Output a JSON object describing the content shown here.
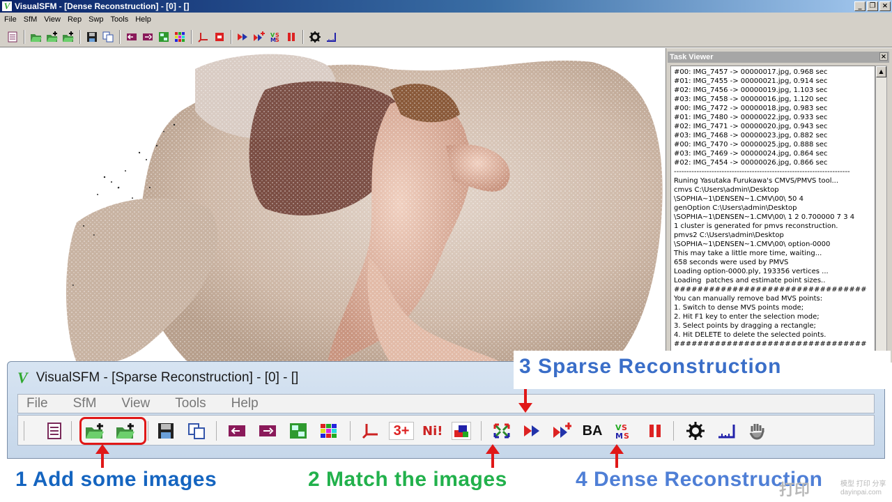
{
  "window": {
    "title": "VisualSFM - [Dense Reconstruction] - [0] - []",
    "logo": "V",
    "controls": {
      "minimize": "_",
      "restore": "❐",
      "close": "×"
    }
  },
  "menu": [
    "File",
    "SfM",
    "View",
    "Rep",
    "Swp",
    "Tools",
    "Help"
  ],
  "toolbar_icons": [
    "log-icon",
    "open-icon",
    "add-images-icon",
    "add-more-icon",
    "save-icon",
    "copy-icon",
    "prev-icon",
    "next-icon",
    "2d3d-icon",
    "grid-icon",
    "axis-icon",
    "stop-icon",
    "run-icon",
    "run-plus-icon",
    "cmvs-icon",
    "pause-icon",
    "gear-icon",
    "ruler-icon"
  ],
  "task_viewer": {
    "title": "Task Viewer",
    "close": "×",
    "lines": [
      "#00: IMG_7457 -> 00000017.jpg, 0.968 sec",
      "#01: IMG_7455 -> 00000021.jpg, 0.914 sec",
      "#02: IMG_7456 -> 00000019.jpg, 1.103 sec",
      "#03: IMG_7458 -> 00000016.jpg, 1.120 sec",
      "#00: IMG_7472 -> 00000018.jpg, 0.983 sec",
      "#01: IMG_7480 -> 00000022.jpg, 0.933 sec",
      "#02: IMG_7471 -> 00000020.jpg, 0.943 sec",
      "#03: IMG_7468 -> 00000023.jpg, 0.882 sec",
      "#00: IMG_7470 -> 00000025.jpg, 0.888 sec",
      "#03: IMG_7469 -> 00000024.jpg, 0.864 sec",
      "#02: IMG_7454 -> 00000026.jpg, 0.866 sec",
      "----------------------------------------------------------------------",
      "Runing Yasutaka Furukawa's CMVS/PMVS tool...",
      "cmvs C:\\Users\\admin\\Desktop",
      "\\SOPHIA~1\\DENSEN~1.CMV\\00\\ 50 4",
      "genOption C:\\Users\\admin\\Desktop",
      "\\SOPHIA~1\\DENSEN~1.CMV\\00\\ 1 2 0.700000 7 3 4",
      "1 cluster is generated for pmvs reconstruction.",
      "pmvs2 C:\\Users\\admin\\Desktop",
      "\\SOPHIA~1\\DENSEN~1.CMV\\00\\ option-0000",
      "This may take a little more time, waiting...",
      "658 seconds were used by PMVS",
      "Loading option-0000.ply, 193356 vertices ...",
      "Loading  patches and estimate point sizes..",
      "#################################",
      "You can manually remove bad MVS points:",
      "1. Switch to dense MVS points mode;",
      "2. Hit F1 key to enter the selection mode;",
      "3. Select points by dragging a rectangle;",
      "4. Hit DELETE to delete the selected points.",
      "#################################"
    ],
    "scroll_up": "▲"
  },
  "inset": {
    "logo": "V",
    "title": "VisualSFM - [Sparse Reconstruction] - [0] - []",
    "menu": [
      "File",
      "SfM",
      "View",
      "Tools",
      "Help"
    ],
    "icons": {
      "three_plus": "3+",
      "ba": "BA"
    }
  },
  "annotations": {
    "step1": "1 Add some images",
    "step2": "2 Match the images",
    "step3": "3 Sparse Reconstruction",
    "step4": "4 Dense Reconstruction"
  },
  "colors": {
    "step1": "#1565c0",
    "step2": "#22b14c",
    "step3": "#3a6ec8",
    "step4": "#4f7fd6",
    "arrow": "#e01818"
  },
  "watermark": {
    "mark": "打印",
    "line1": "模型 打印 分享",
    "line2": "dayinpai.com"
  }
}
